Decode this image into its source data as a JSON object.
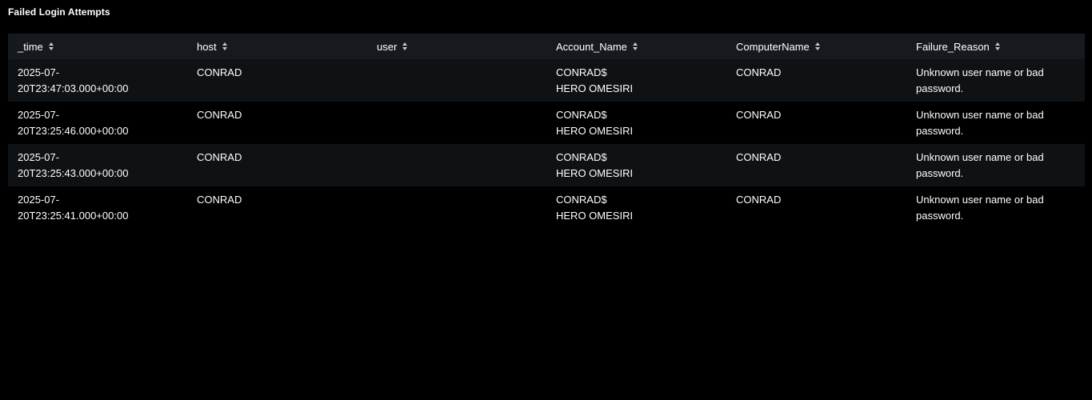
{
  "panel": {
    "title": "Failed Login Attempts"
  },
  "table": {
    "columns": [
      {
        "label": "_time",
        "sort_icon": "sort-icon"
      },
      {
        "label": "host",
        "sort_icon": "sort-icon"
      },
      {
        "label": "user",
        "sort_icon": "sort-icon"
      },
      {
        "label": "Account_Name",
        "sort_icon": "sort-icon"
      },
      {
        "label": "ComputerName",
        "sort_icon": "sort-icon"
      },
      {
        "label": "Failure_Reason",
        "sort_icon": "sort-icon"
      }
    ],
    "rows": [
      {
        "time": [
          "2025-07-",
          "20T23:47:03.000+00:00"
        ],
        "host": "CONRAD",
        "user": "",
        "account_name": [
          "CONRAD$",
          "HERO OMESIRI"
        ],
        "computer_name": "CONRAD",
        "failure_reason": "Unknown user name or bad password."
      },
      {
        "time": [
          "2025-07-",
          "20T23:25:46.000+00:00"
        ],
        "host": "CONRAD",
        "user": "",
        "account_name": [
          "CONRAD$",
          "HERO OMESIRI"
        ],
        "computer_name": "CONRAD",
        "failure_reason": "Unknown user name or bad password."
      },
      {
        "time": [
          "2025-07-",
          "20T23:25:43.000+00:00"
        ],
        "host": "CONRAD",
        "user": "",
        "account_name": [
          "CONRAD$",
          "HERO OMESIRI"
        ],
        "computer_name": "CONRAD",
        "failure_reason": "Unknown user name or bad password."
      },
      {
        "time": [
          "2025-07-",
          "20T23:25:41.000+00:00"
        ],
        "host": "CONRAD",
        "user": "",
        "account_name": [
          "CONRAD$",
          "HERO OMESIRI"
        ],
        "computer_name": "CONRAD",
        "failure_reason": "Unknown user name or bad password."
      }
    ]
  },
  "colors": {
    "background": "#000000",
    "header_bg": "#161a1f",
    "row_alt_bg": "#0f1215",
    "text": "#ffffff"
  }
}
